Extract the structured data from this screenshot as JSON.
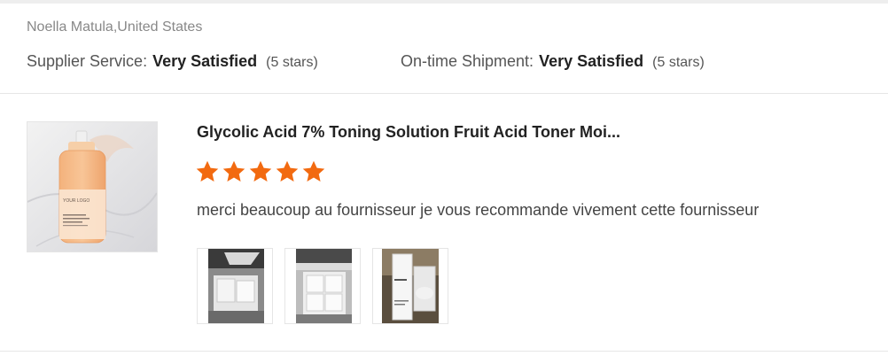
{
  "reviewer": {
    "name_location": "Noella Matula,United States"
  },
  "ratings": [
    {
      "label": "Supplier Service:",
      "value": "Very Satisfied",
      "stars_text": "(5 stars)"
    },
    {
      "label": "On-time Shipment:",
      "value": "Very Satisfied",
      "stars_text": "(5 stars)"
    }
  ],
  "product": {
    "title": "Glycolic Acid 7%  Toning Solution Fruit Acid Toner Moi...",
    "image_icon": "product-bottle-image",
    "logo_text": "YOUR LOGO"
  },
  "review": {
    "rating": 5,
    "max_rating": 5,
    "text": "merci beaucoup au fournisseur je vous recommande vivement cette fournisseur"
  },
  "photos": [
    {
      "icon": "boxes-photo"
    },
    {
      "icon": "open-box-photo"
    },
    {
      "icon": "product-boxes-photo"
    }
  ],
  "colors": {
    "star": "#f26a10",
    "divider": "#e6e6e6",
    "title_text": "#222222",
    "muted_text": "#888888"
  }
}
